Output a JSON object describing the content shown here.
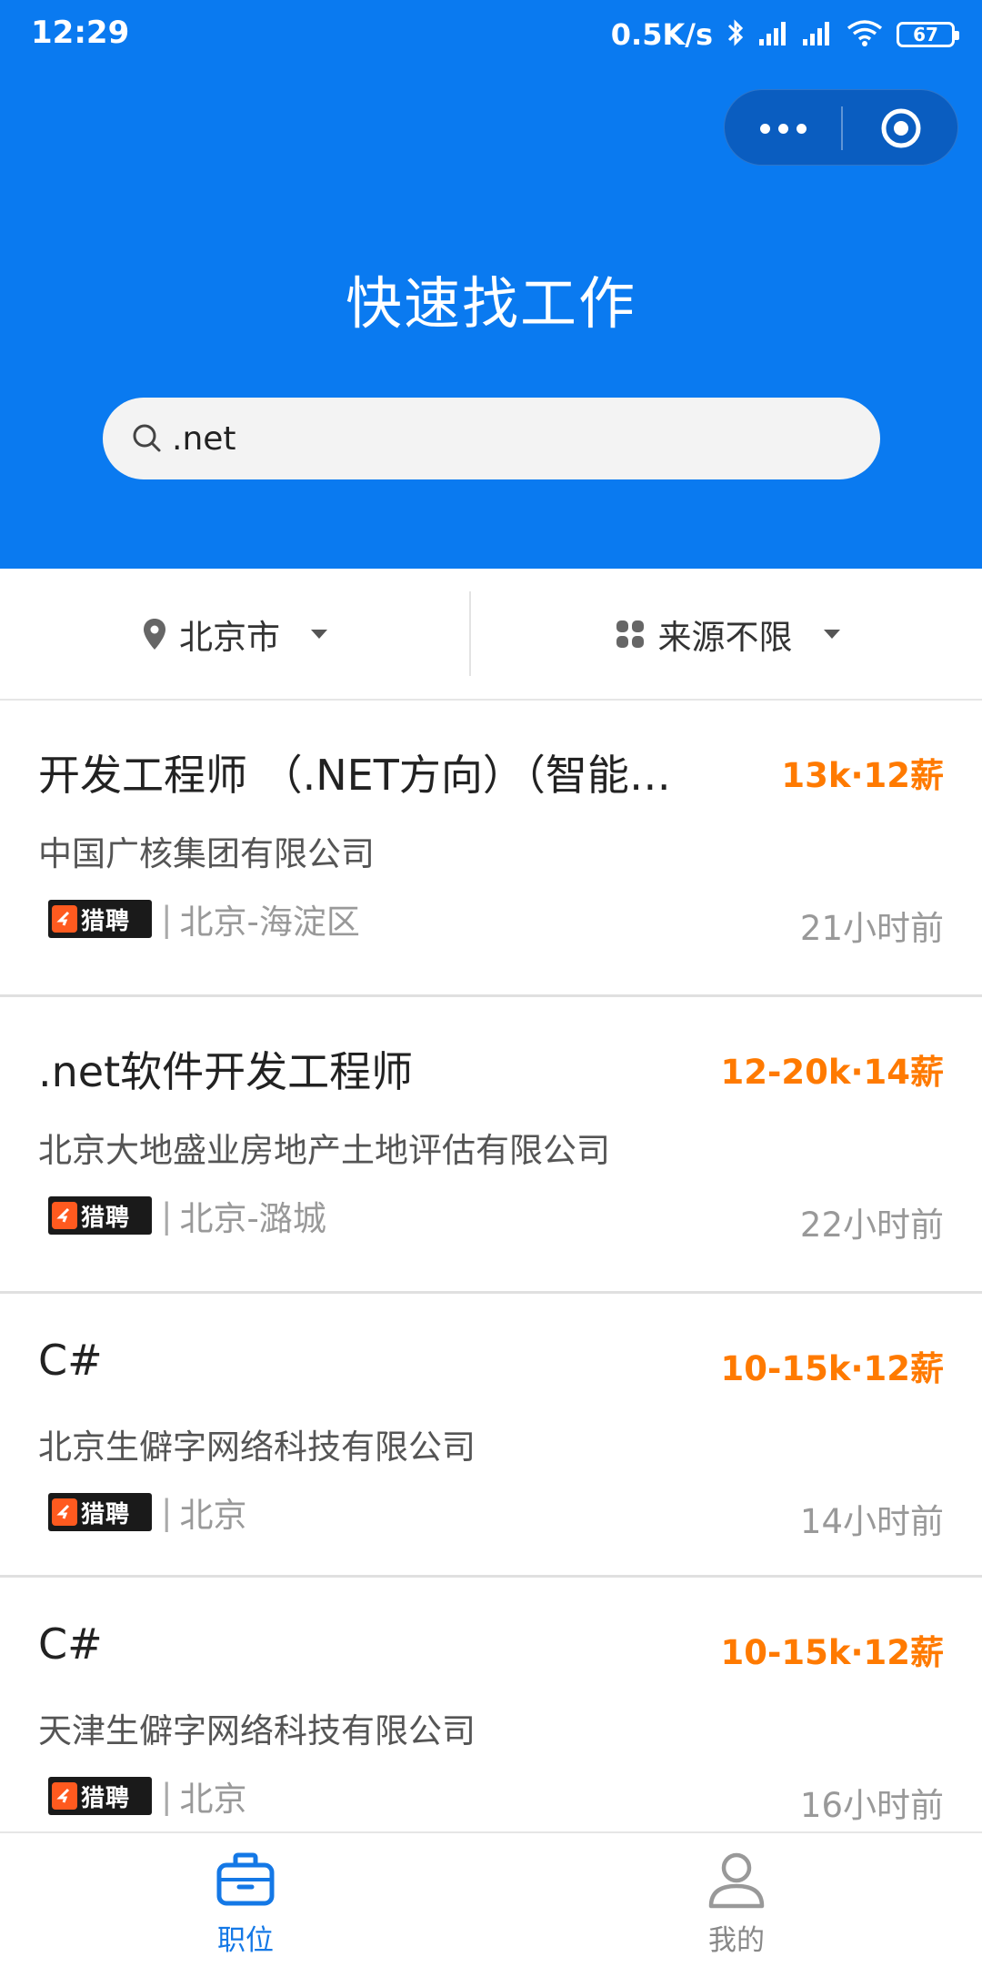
{
  "status_bar": {
    "time": "12:29",
    "net_speed": "0.5K/s",
    "battery": "67"
  },
  "capsule": {
    "more_icon": "more-dots-icon",
    "close_icon": "target-close-icon"
  },
  "header": {
    "title": "快速找工作"
  },
  "search": {
    "value": ".net",
    "icon": "search-icon"
  },
  "filters": {
    "city": "北京市",
    "source": "来源不限"
  },
  "jobs": [
    {
      "title": "开发工程师 （.NET方向）（智能化方向）",
      "salary": "13k·12薪",
      "company": "中国广核集团有限公司",
      "source_logo": "猎聘",
      "location": "北京-海淀区",
      "time": "21小时前"
    },
    {
      "title": ".net软件开发工程师",
      "salary": "12-20k·14薪",
      "company": "北京大地盛业房地产土地评估有限公司",
      "source_logo": "猎聘",
      "location": "北京-潞城",
      "time": "22小时前"
    },
    {
      "title": "C#",
      "salary": "10-15k·12薪",
      "company": "北京生僻字网络科技有限公司",
      "source_logo": "猎聘",
      "location": "北京",
      "time": "14小时前"
    },
    {
      "title": "C#",
      "salary": "10-15k·12薪",
      "company": "天津生僻字网络科技有限公司",
      "source_logo": "猎聘",
      "location": "北京",
      "time": "16小时前"
    }
  ],
  "tabbar": {
    "jobs_label": "职位",
    "mine_label": "我的"
  },
  "colors": {
    "primary": "#0a7af0",
    "salary": "#ff7a00",
    "tab_active": "#1478e6"
  }
}
